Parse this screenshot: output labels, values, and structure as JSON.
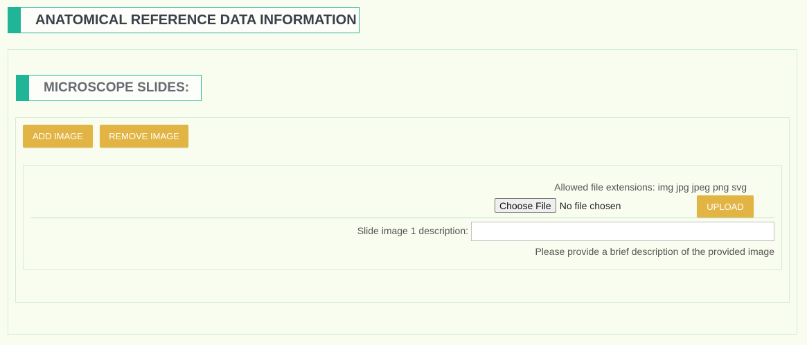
{
  "page": {
    "title": "ANATOMICAL REFERENCE DATA INFORMATION"
  },
  "slides_section": {
    "title": "MICROSCOPE SLIDES:",
    "add_image_label": "ADD IMAGE",
    "remove_image_label": "REMOVE IMAGE",
    "image_entry": {
      "allowed_extensions_text": "Allowed file extensions: img jpg jpeg png svg",
      "choose_file_label": "Choose File",
      "no_file_text": "No file chosen",
      "upload_label": "UPLOAD",
      "description_label": "Slide image 1 description:",
      "description_value": "",
      "description_help": "Please provide a brief description of the provided image"
    }
  },
  "colors": {
    "accent": "#1fb596",
    "button": "#e2b444",
    "background": "#f9fdef"
  }
}
